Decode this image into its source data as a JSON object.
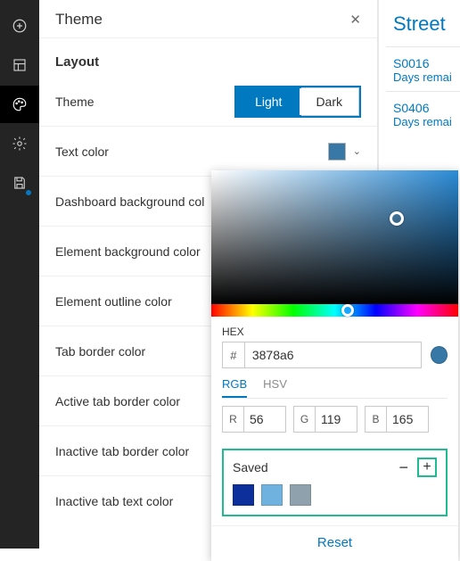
{
  "panel": {
    "title": "Theme",
    "section": "Layout",
    "rows": {
      "theme": "Theme",
      "text_color": "Text color",
      "dash_bg": "Dashboard background col",
      "elem_bg": "Element background color",
      "elem_outline": "Element outline color",
      "tab_border": "Tab border color",
      "active_tab": "Active tab border color",
      "inactive_tab_border": "Inactive tab border color",
      "inactive_tab_text": "Inactive tab text color"
    },
    "segmented": {
      "light": "Light",
      "dark": "Dark"
    },
    "text_swatch": "#3878a6"
  },
  "right": {
    "title": "Street",
    "items": [
      {
        "id": "S0016",
        "sub": "Days remai"
      },
      {
        "id": "S0406",
        "sub": "Days remai"
      }
    ]
  },
  "picker": {
    "hex_label": "HEX",
    "hex_value": "3878a6",
    "preview_color": "#3878a6",
    "tabs": {
      "rgb": "RGB",
      "hsv": "HSV"
    },
    "rgb": {
      "r": "56",
      "g": "119",
      "b": "165"
    },
    "saved_label": "Saved",
    "saved_colors": [
      "#0c2f9b",
      "#6fb1df",
      "#8ea1ad"
    ],
    "reset": "Reset"
  }
}
